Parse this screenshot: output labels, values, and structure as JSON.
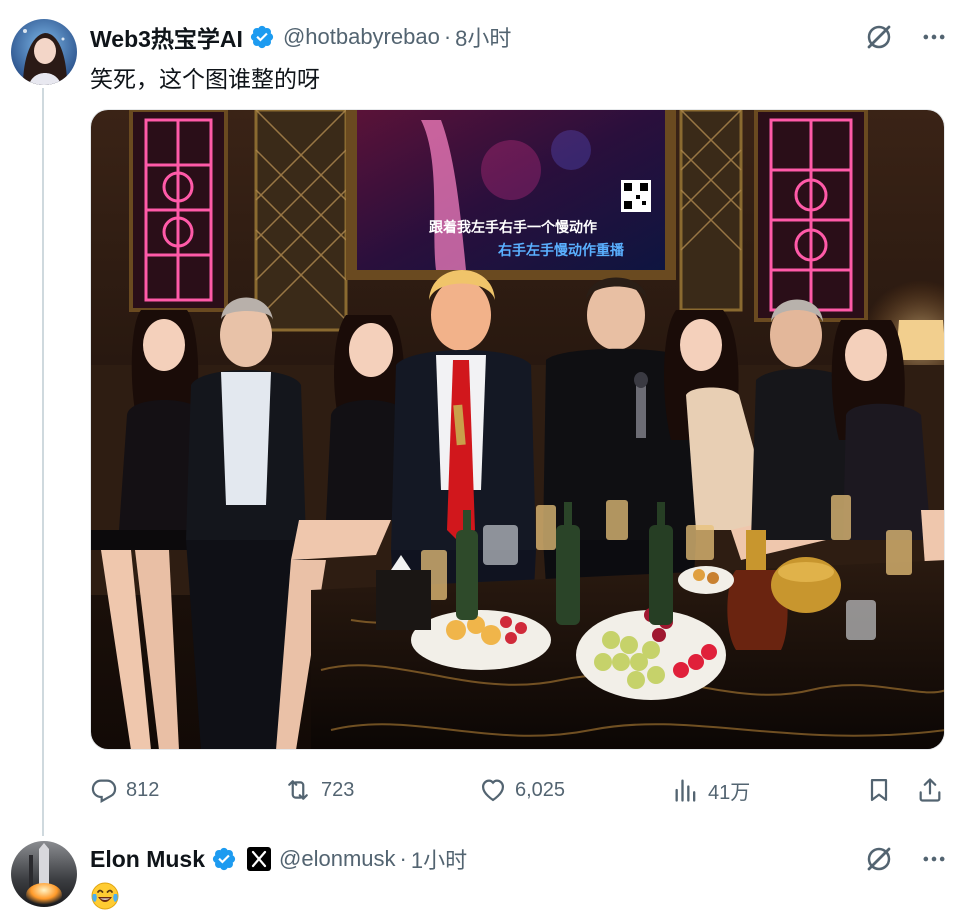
{
  "tweet1": {
    "display_name": "Web3热宝学AI",
    "handle": "@hotbabyrebao",
    "separator": "·",
    "time": "8小时",
    "text": "笑死，这个图谁整的呀",
    "image": {
      "screen_line1": "跟着我左手右手一个慢动作",
      "screen_line2": "右手左手慢动作重播"
    },
    "actions": {
      "replies": "812",
      "retweets": "723",
      "likes": "6,025",
      "views": "41万"
    }
  },
  "tweet2": {
    "display_name": "Elon Musk",
    "handle": "@elonmusk",
    "separator": "·",
    "time": "1小时",
    "emoji": "face-with-tears-of-joy"
  },
  "colors": {
    "verified": "#1d9bf0",
    "muted": "#536471",
    "text": "#0f1419",
    "thread_line": "#cfd9de"
  },
  "icons": [
    "grok-icon",
    "more-icon",
    "reply-icon",
    "retweet-icon",
    "like-icon",
    "views-icon",
    "bookmark-icon",
    "share-icon",
    "verified-badge-icon",
    "x-affiliate-icon"
  ]
}
